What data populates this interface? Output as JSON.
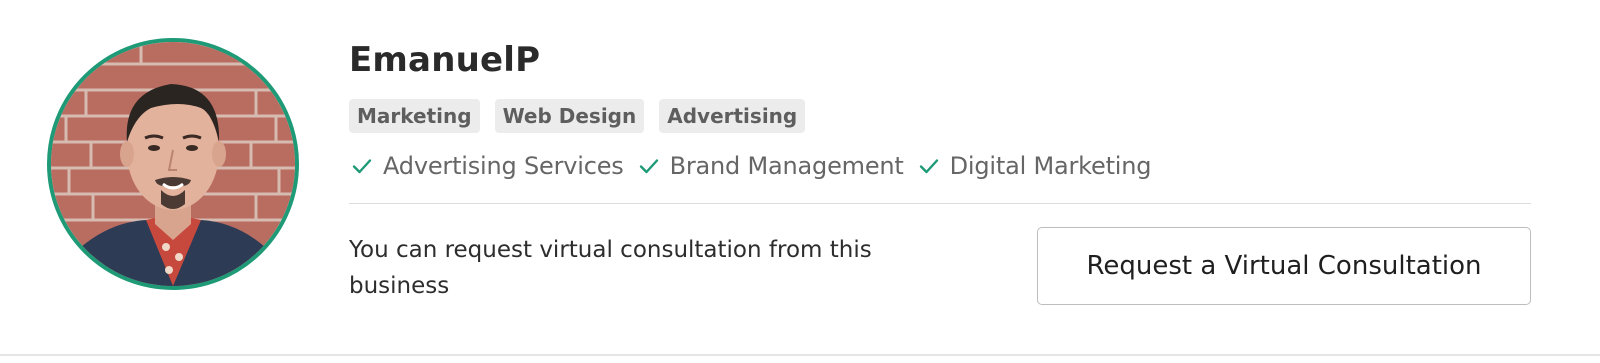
{
  "profile": {
    "name": "EmanuelP",
    "tags": [
      "Marketing",
      "Web Design",
      "Advertising"
    ],
    "services": [
      "Advertising Services",
      "Brand Management",
      "Digital Marketing"
    ],
    "consultation_text": "You can request virtual consultation from this business",
    "consultation_button_label": "Request a Virtual Consultation"
  },
  "icons": {
    "avatar": "person-photo",
    "check": "check-icon"
  },
  "colors": {
    "avatar_border": "#1e9a76",
    "check": "#1e9a76",
    "tag_background": "#ececec",
    "tag_text": "#5e5e5e",
    "service_text": "#666666"
  }
}
